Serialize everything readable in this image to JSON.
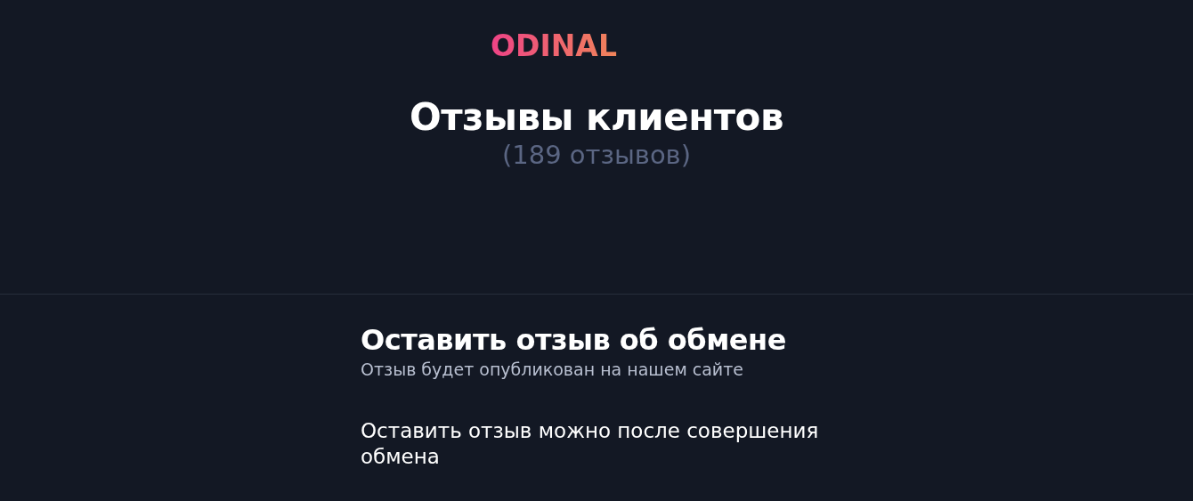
{
  "logo": "ODINAL",
  "header": {
    "title": "Отзывы клиентов",
    "count": "(189 отзывов)"
  },
  "review_form": {
    "title": "Оставить отзыв об обмене",
    "subtitle": "Отзыв будет опубликован на нашем сайте",
    "notice": "Оставить отзыв можно после совершения обмена"
  }
}
